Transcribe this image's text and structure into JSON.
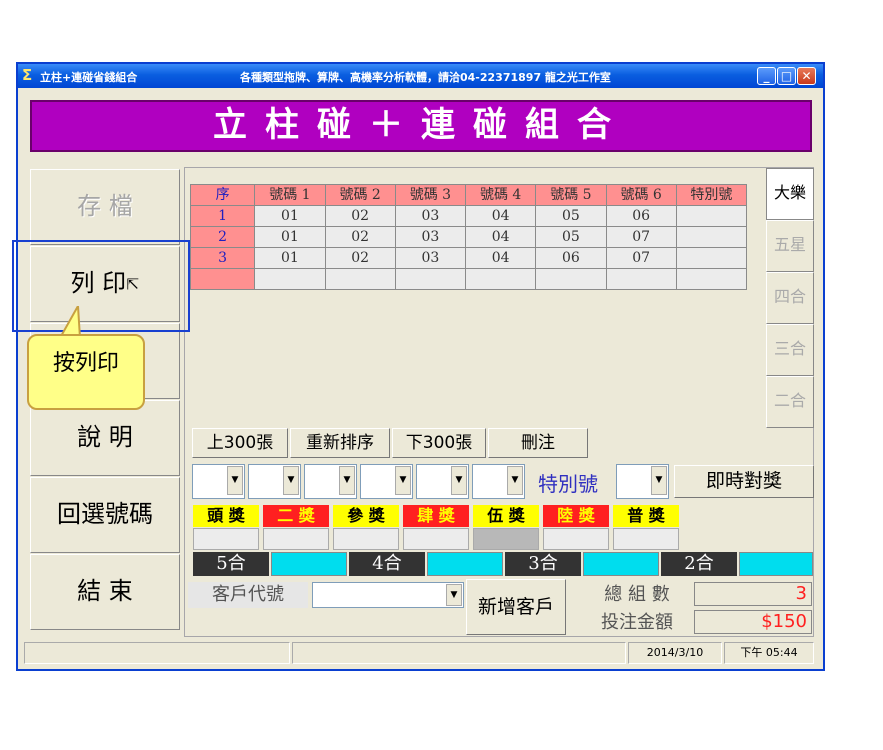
{
  "window": {
    "title": "立柱+連碰省錢組合",
    "message": "各種類型拖牌、算牌、高機率分析軟體，請洽04-22371897 龍之光工作室",
    "banner": "立柱碰＋連碰組合"
  },
  "sidebar": {
    "save": "存 檔",
    "print": "列 印",
    "help": "說 明",
    "select_back": "回選號碼",
    "exit": "結 束"
  },
  "grid": {
    "headers": [
      "序",
      "號碼 1",
      "號碼 2",
      "號碼 3",
      "號碼 4",
      "號碼 5",
      "號碼 6",
      "特別號"
    ],
    "rows": [
      [
        "1",
        "01",
        "02",
        "03",
        "04",
        "05",
        "06",
        ""
      ],
      [
        "2",
        "01",
        "02",
        "03",
        "04",
        "05",
        "07",
        ""
      ],
      [
        "3",
        "01",
        "02",
        "03",
        "04",
        "06",
        "07",
        ""
      ]
    ]
  },
  "tabs": [
    "大樂",
    "五星",
    "四合",
    "三合",
    "二合"
  ],
  "actions": {
    "prev300": "上300張",
    "resort": "重新排序",
    "next300": "下300張",
    "delete": "刪注"
  },
  "draw": {
    "special_label": "特別號",
    "check_button": "即時對獎"
  },
  "prizes": [
    {
      "label": "頭 獎",
      "bg": "#ffff00",
      "fg": "#000000"
    },
    {
      "label": "二 獎",
      "bg": "#ff2020",
      "fg": "#ffff00"
    },
    {
      "label": "參 獎",
      "bg": "#ffff00",
      "fg": "#000000"
    },
    {
      "label": "肆 獎",
      "bg": "#ff2020",
      "fg": "#ffff00"
    },
    {
      "label": "伍 獎",
      "bg": "#ffff00",
      "fg": "#000000"
    },
    {
      "label": "陸 獎",
      "bg": "#ff2020",
      "fg": "#ffff00"
    },
    {
      "label": "普 獎",
      "bg": "#ffff00",
      "fg": "#000000"
    }
  ],
  "hits": [
    "5合",
    "4合",
    "3合",
    "2合"
  ],
  "customer": {
    "label": "客戶代號",
    "new_button": "新增客戶"
  },
  "totals": {
    "count_label": "總 組 數",
    "count_value": "3",
    "amount_label": "投注金額",
    "amount_value": "$150"
  },
  "status": {
    "date": "2014/3/10",
    "time": "下午 05:44"
  },
  "tooltip": {
    "text": "按列印"
  },
  "colors": {
    "banner": "#b000c0",
    "header_cell": "#ff9090",
    "hit_box": "#00ddee",
    "total_value": "#ff2020"
  }
}
